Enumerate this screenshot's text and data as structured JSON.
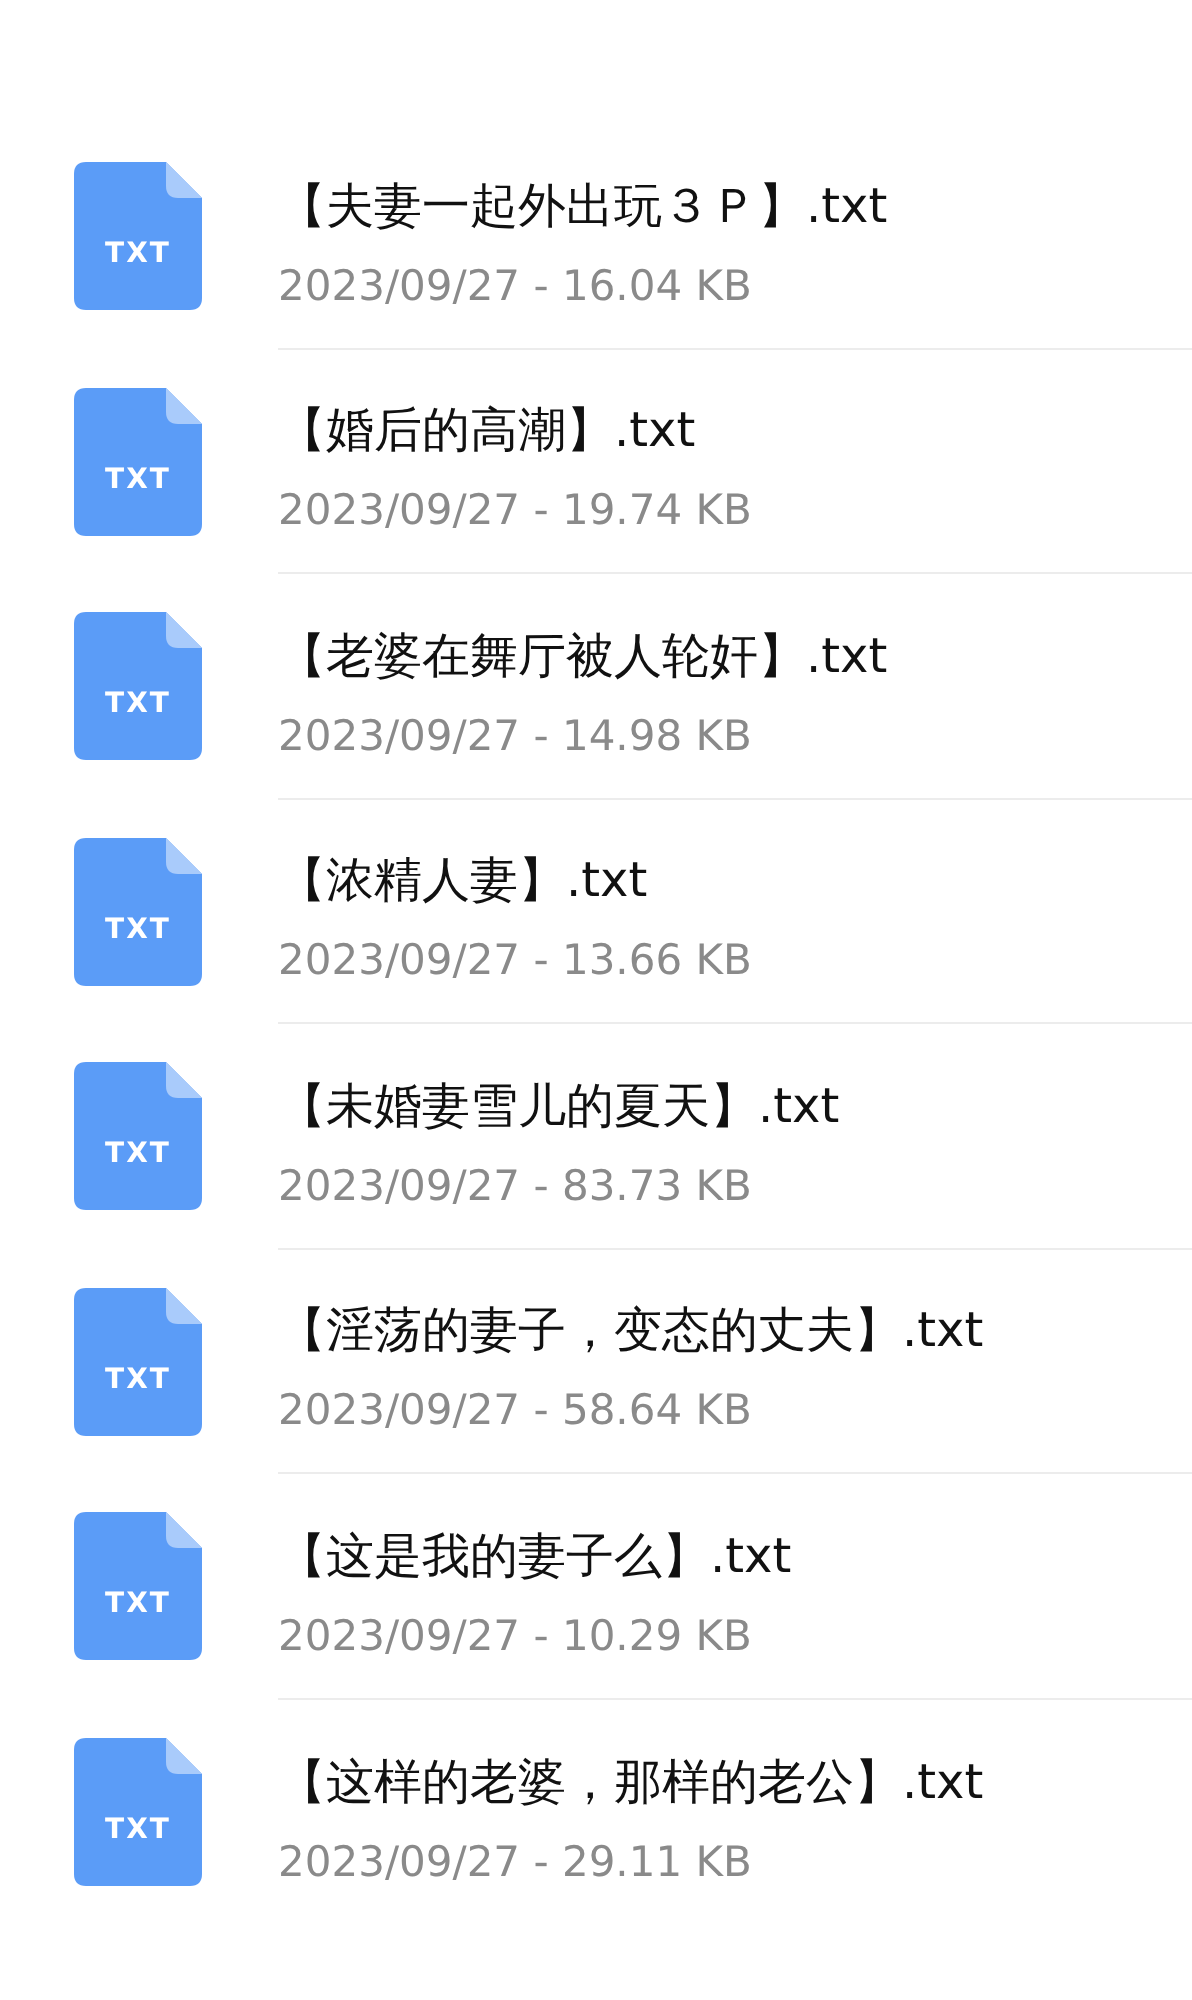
{
  "files": [
    {
      "badge": "TXT",
      "name": "【夫妻一起外出玩３Ｐ】.txt",
      "meta": "2023/09/27 - 16.04 KB"
    },
    {
      "badge": "TXT",
      "name": "【婚后的高潮】.txt",
      "meta": "2023/09/27 - 19.74 KB"
    },
    {
      "badge": "TXT",
      "name": "【老婆在舞厅被人轮奸】.txt",
      "meta": "2023/09/27 - 14.98 KB"
    },
    {
      "badge": "TXT",
      "name": "【浓精人妻】.txt",
      "meta": "2023/09/27 - 13.66 KB"
    },
    {
      "badge": "TXT",
      "name": "【未婚妻雪儿的夏天】.txt",
      "meta": "2023/09/27 - 83.73 KB"
    },
    {
      "badge": "TXT",
      "name": "【淫荡的妻子，变态的丈夫】.txt",
      "meta": "2023/09/27 - 58.64 KB"
    },
    {
      "badge": "TXT",
      "name": "【这是我的妻子么】.txt",
      "meta": "2023/09/27 - 10.29 KB"
    },
    {
      "badge": "TXT",
      "name": "【这样的老婆，那样的老公】.txt",
      "meta": "2023/09/27 - 29.11 KB"
    }
  ]
}
